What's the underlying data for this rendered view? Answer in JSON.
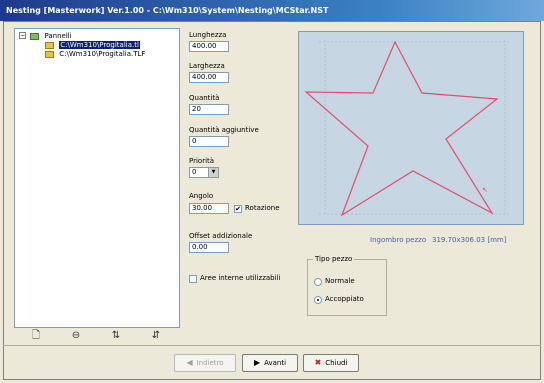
{
  "window": {
    "title": "Nesting [Masterwork] Ver.1.00 - C:\\Wm310\\System\\Nesting\\MCStar.NST"
  },
  "tree": {
    "root_label": "Pannelli",
    "expander": "−",
    "items": [
      {
        "label": "C:\\Wm310\\Progitalia.tl"
      },
      {
        "label": "C:\\Wm310\\Progitalia.TLF"
      }
    ]
  },
  "left_toolbar": {
    "icons": [
      "new-icon",
      "open-icon",
      "add-icon",
      "remove-icon"
    ],
    "glyphs": [
      "🗋",
      "⊖",
      "⇅",
      "⇵"
    ]
  },
  "fields": {
    "lunghezza": {
      "label": "Lunghezza",
      "value": "400.00"
    },
    "larghezza": {
      "label": "Larghezza",
      "value": "400.00"
    },
    "quantita": {
      "label": "Quantità",
      "value": "20"
    },
    "quantita_aggiuntive": {
      "label": "Quantità aggiuntive",
      "value": "0"
    },
    "priorita": {
      "label": "Priorità",
      "value": "0"
    },
    "angolo": {
      "label": "Angolo",
      "value": "30.00"
    },
    "rotazione": {
      "label": "Rotazione",
      "checked": true,
      "check_glyph": "✔"
    },
    "offset": {
      "label": "Offset addizionale",
      "value": "0.00"
    },
    "aree_interne": {
      "label": "Aree interne utilizzabili",
      "checked": false
    }
  },
  "preview": {
    "info_label": "Ingombro pezzo",
    "info_value": "319.70x306.03 [mm]",
    "shape_color": "#e0506a",
    "bg_color": "#c6d6e3"
  },
  "tipo_pezzo": {
    "title": "Tipo pezzo",
    "options": [
      {
        "label": "Normale",
        "checked": false
      },
      {
        "label": "Accoppiato",
        "checked": true
      }
    ]
  },
  "buttons": {
    "indietro": {
      "label": "Indietro",
      "icon": "◀"
    },
    "avanti": {
      "label": "Avanti",
      "icon": "▶"
    },
    "chiudi": {
      "label": "Chiudi",
      "icon": "✖"
    }
  }
}
